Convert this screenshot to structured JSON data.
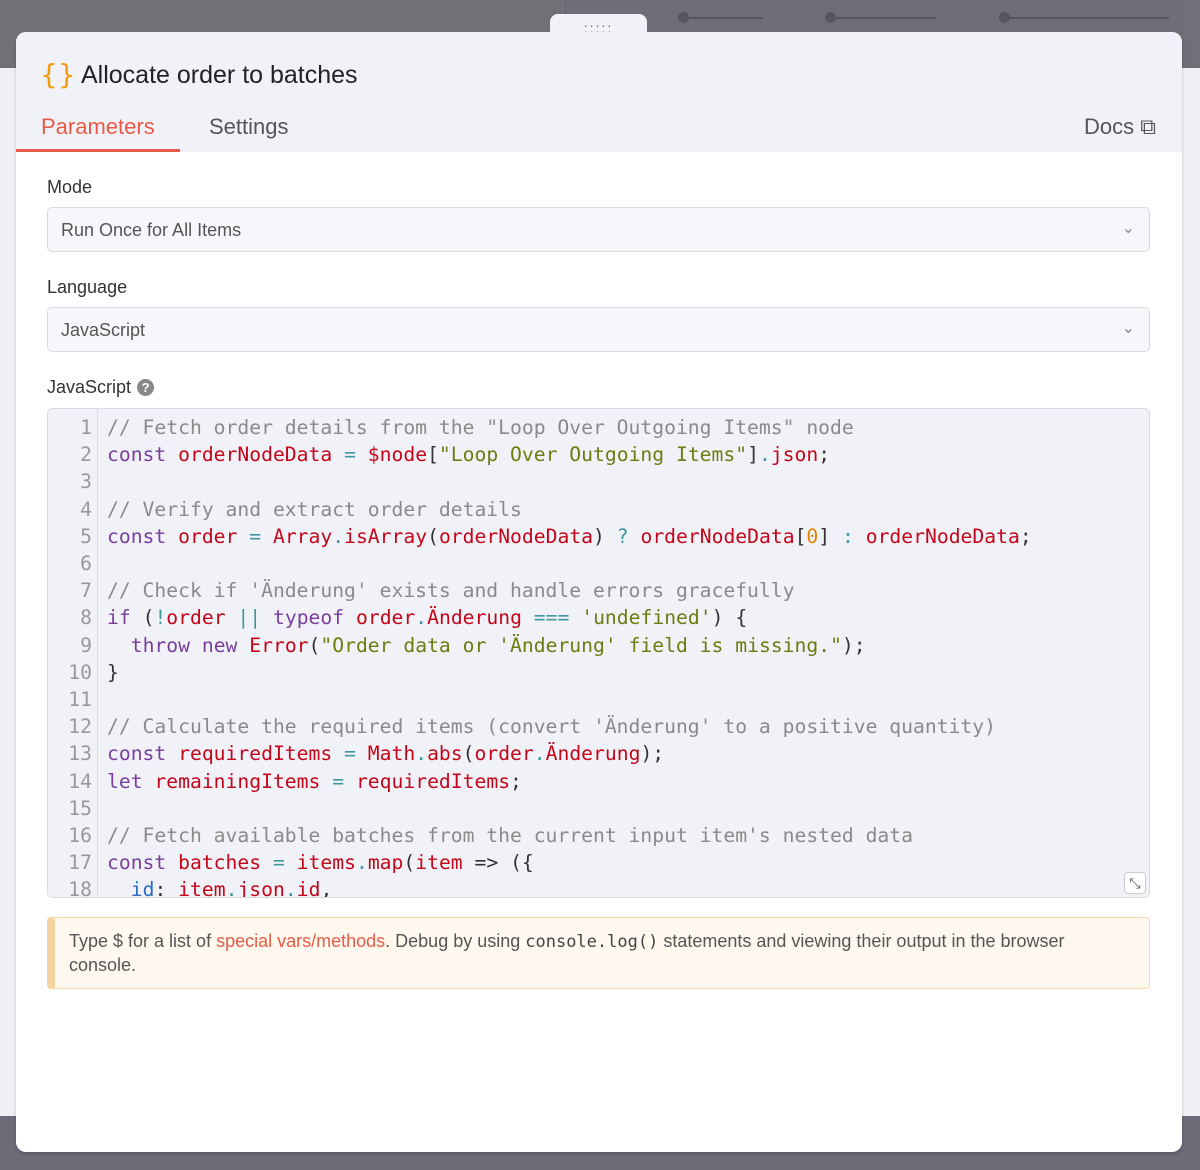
{
  "node": {
    "icon": "{}",
    "title": "Allocate order to batches"
  },
  "tabs": [
    {
      "label": "Parameters",
      "active": true
    },
    {
      "label": "Settings",
      "active": false
    }
  ],
  "docs_label": "Docs",
  "drag_handle": ":::::",
  "mode": {
    "label": "Mode",
    "value": "Run Once for All Items"
  },
  "language": {
    "label": "Language",
    "value": "JavaScript"
  },
  "code_label": "JavaScript",
  "accent_color": "#ea5a46",
  "code_lines": [
    [
      [
        "c",
        "// Fetch order details from the \"Loop Over Outgoing Items\" node"
      ]
    ],
    [
      [
        "k",
        "const"
      ],
      [
        "p",
        " "
      ],
      [
        "v",
        "orderNodeData"
      ],
      [
        "p",
        " "
      ],
      [
        "o",
        "="
      ],
      [
        "p",
        " "
      ],
      [
        "v",
        "$node"
      ],
      [
        "p",
        "["
      ],
      [
        "s",
        "\"Loop Over Outgoing Items\""
      ],
      [
        "p",
        "]"
      ],
      [
        "o",
        "."
      ],
      [
        "v",
        "json"
      ],
      [
        "p",
        ";"
      ]
    ],
    [],
    [
      [
        "c",
        "// Verify and extract order details"
      ]
    ],
    [
      [
        "k",
        "const"
      ],
      [
        "p",
        " "
      ],
      [
        "v",
        "order"
      ],
      [
        "p",
        " "
      ],
      [
        "o",
        "="
      ],
      [
        "p",
        " "
      ],
      [
        "v",
        "Array"
      ],
      [
        "o",
        "."
      ],
      [
        "v",
        "isArray"
      ],
      [
        "p",
        "("
      ],
      [
        "v",
        "orderNodeData"
      ],
      [
        "p",
        ") "
      ],
      [
        "o",
        "?"
      ],
      [
        "p",
        " "
      ],
      [
        "v",
        "orderNodeData"
      ],
      [
        "p",
        "["
      ],
      [
        "n",
        "0"
      ],
      [
        "p",
        "] "
      ],
      [
        "o",
        ":"
      ],
      [
        "p",
        " "
      ],
      [
        "v",
        "orderNodeData"
      ],
      [
        "p",
        ";"
      ]
    ],
    [],
    [
      [
        "c",
        "// Check if 'Änderung' exists and handle errors gracefully"
      ]
    ],
    [
      [
        "k",
        "if"
      ],
      [
        "p",
        " ("
      ],
      [
        "o",
        "!"
      ],
      [
        "v",
        "order"
      ],
      [
        "p",
        " "
      ],
      [
        "o",
        "||"
      ],
      [
        "p",
        " "
      ],
      [
        "k",
        "typeof"
      ],
      [
        "p",
        " "
      ],
      [
        "v",
        "order"
      ],
      [
        "o",
        "."
      ],
      [
        "v",
        "Änderung"
      ],
      [
        "p",
        " "
      ],
      [
        "o",
        "==="
      ],
      [
        "p",
        " "
      ],
      [
        "s",
        "'undefined'"
      ],
      [
        "p",
        ") {"
      ]
    ],
    [
      [
        "p",
        "  "
      ],
      [
        "k",
        "throw"
      ],
      [
        "p",
        " "
      ],
      [
        "k",
        "new"
      ],
      [
        "p",
        " "
      ],
      [
        "v",
        "Error"
      ],
      [
        "p",
        "("
      ],
      [
        "s",
        "\"Order data or 'Änderung' field is missing.\""
      ],
      [
        "p",
        ");"
      ]
    ],
    [
      [
        "p",
        "}"
      ]
    ],
    [],
    [
      [
        "c",
        "// Calculate the required items (convert 'Änderung' to a positive quantity)"
      ]
    ],
    [
      [
        "k",
        "const"
      ],
      [
        "p",
        " "
      ],
      [
        "v",
        "requiredItems"
      ],
      [
        "p",
        " "
      ],
      [
        "o",
        "="
      ],
      [
        "p",
        " "
      ],
      [
        "v",
        "Math"
      ],
      [
        "o",
        "."
      ],
      [
        "v",
        "abs"
      ],
      [
        "p",
        "("
      ],
      [
        "v",
        "order"
      ],
      [
        "o",
        "."
      ],
      [
        "v",
        "Änderung"
      ],
      [
        "p",
        ");"
      ]
    ],
    [
      [
        "k",
        "let"
      ],
      [
        "p",
        " "
      ],
      [
        "v",
        "remainingItems"
      ],
      [
        "p",
        " "
      ],
      [
        "o",
        "="
      ],
      [
        "p",
        " "
      ],
      [
        "v",
        "requiredItems"
      ],
      [
        "p",
        ";"
      ]
    ],
    [],
    [
      [
        "c",
        "// Fetch available batches from the current input item's nested data"
      ]
    ],
    [
      [
        "k",
        "const"
      ],
      [
        "p",
        " "
      ],
      [
        "v",
        "batches"
      ],
      [
        "p",
        " "
      ],
      [
        "o",
        "="
      ],
      [
        "p",
        " "
      ],
      [
        "v",
        "items"
      ],
      [
        "o",
        "."
      ],
      [
        "v",
        "map"
      ],
      [
        "p",
        "("
      ],
      [
        "v",
        "item"
      ],
      [
        "p",
        " => ({"
      ]
    ],
    [
      [
        "p",
        "  "
      ],
      [
        "b",
        "id"
      ],
      [
        "p",
        ": "
      ],
      [
        "v",
        "item"
      ],
      [
        "o",
        "."
      ],
      [
        "v",
        "json"
      ],
      [
        "o",
        "."
      ],
      [
        "v",
        "id"
      ],
      [
        "p",
        ","
      ]
    ]
  ],
  "notice": {
    "prefix": "Type $ for a list of ",
    "link": "special vars/methods",
    "middle": ". Debug by using ",
    "code": "console.log()",
    "suffix": " statements and viewing their output in the browser console."
  }
}
